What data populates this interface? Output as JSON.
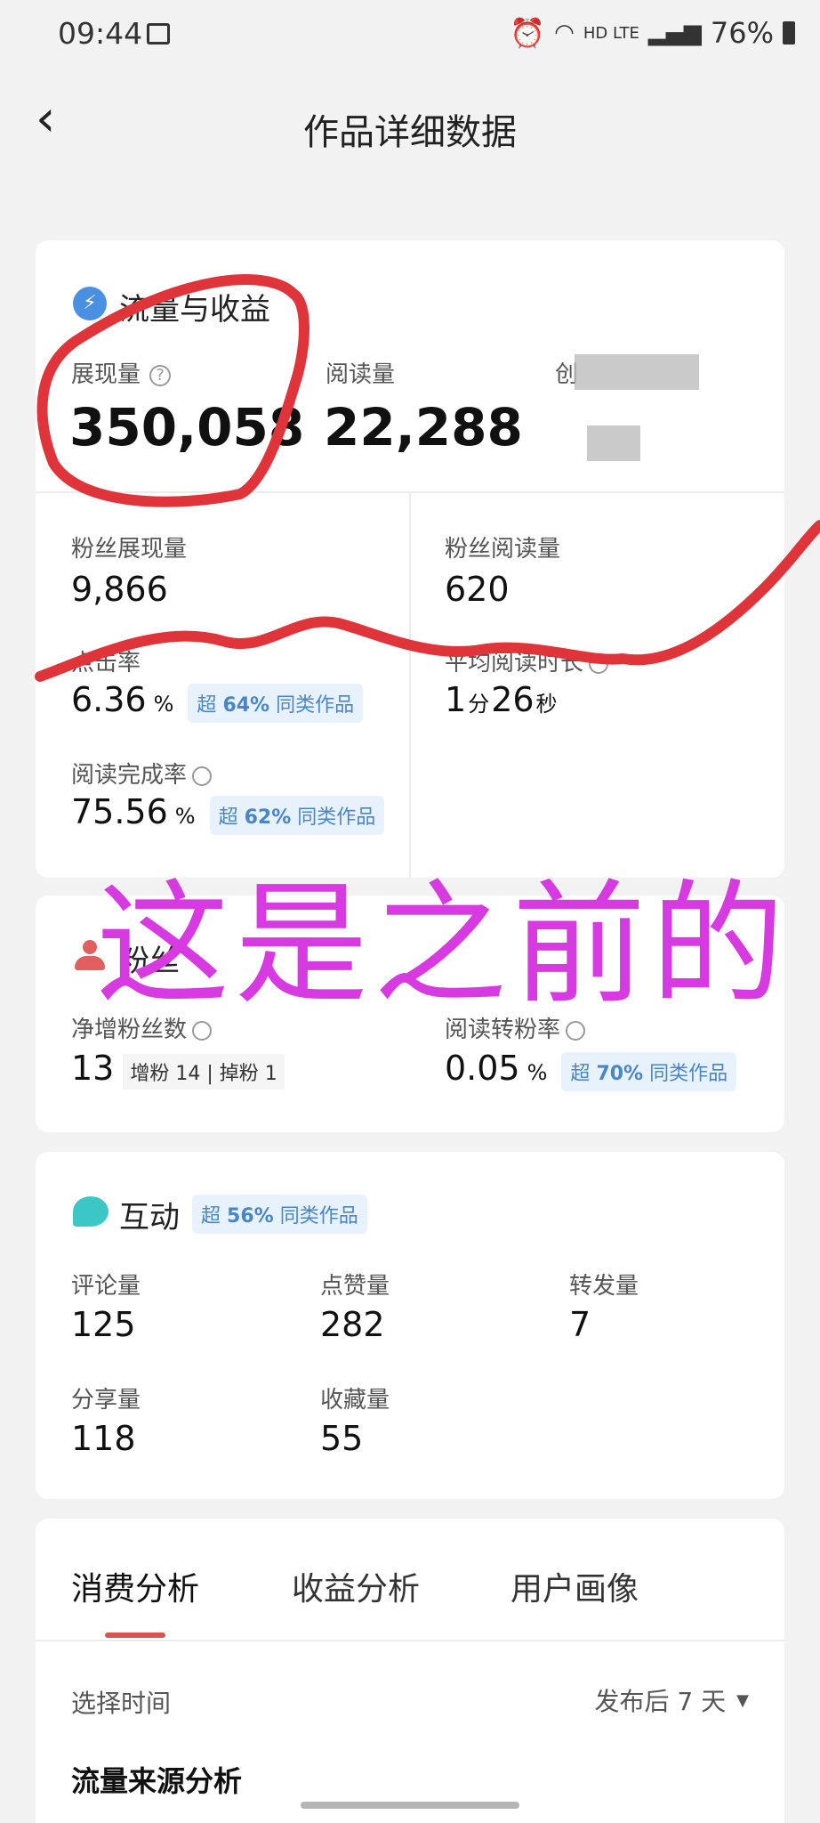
{
  "status_bar": {
    "time": "09:44",
    "right_text": "HD LTE",
    "battery": "76%"
  },
  "header": {
    "title": "作品详细数据"
  },
  "traffic": {
    "title": "流量与收益",
    "impressions_label": "展现量",
    "impressions_value": "350,058",
    "reads_label": "阅读量",
    "reads_value": "22,288",
    "third_label_prefix": "创",
    "fan_impressions_label": "粉丝展现量",
    "fan_impressions_value": "9,866",
    "fan_reads_label": "粉丝阅读量",
    "fan_reads_value": "620",
    "ctr_label": "点击率",
    "ctr_value": "6.36",
    "ctr_unit": "%",
    "ctr_badge_pre": "超",
    "ctr_badge_pct": "64%",
    "ctr_badge_post": "同类作品",
    "avg_time_label": "平均阅读时长",
    "avg_time_m": "1",
    "avg_time_m_unit": "分",
    "avg_time_s": "26",
    "avg_time_s_unit": "秒",
    "completion_label": "阅读完成率",
    "completion_value": "75.56",
    "completion_unit": "%",
    "completion_badge_pre": "超",
    "completion_badge_pct": "62%",
    "completion_badge_post": "同类作品"
  },
  "fans": {
    "title": "粉丝",
    "net_label": "净增粉丝数",
    "net_value": "13",
    "gain_label": "增粉",
    "gain_value": "14",
    "loss_label": "掉粉",
    "loss_value": "1",
    "conv_label": "阅读转粉率",
    "conv_value": "0.05",
    "conv_unit": "%",
    "conv_badge_pre": "超",
    "conv_badge_pct": "70%",
    "conv_badge_post": "同类作品"
  },
  "interaction": {
    "title": "互动",
    "badge_pre": "超",
    "badge_pct": "56%",
    "badge_post": "同类作品",
    "comments_label": "评论量",
    "comments_value": "125",
    "likes_label": "点赞量",
    "likes_value": "282",
    "forwards_label": "转发量",
    "forwards_value": "7",
    "shares_label": "分享量",
    "shares_value": "118",
    "favorites_label": "收藏量",
    "favorites_value": "55"
  },
  "tabs": [
    "消费分析",
    "收益分析",
    "用户画像"
  ],
  "analysis": {
    "select_time_label": "选择时间",
    "select_time_value": "发布后 7 天",
    "source_title": "流量来源分析"
  },
  "overlay": {
    "handwritten_text": "这是之前的"
  },
  "colors": {
    "accent": "#d9534f",
    "badge_text": "#4a86c6",
    "annotation": "#e0343b",
    "handwriting": "#d63ae0"
  }
}
